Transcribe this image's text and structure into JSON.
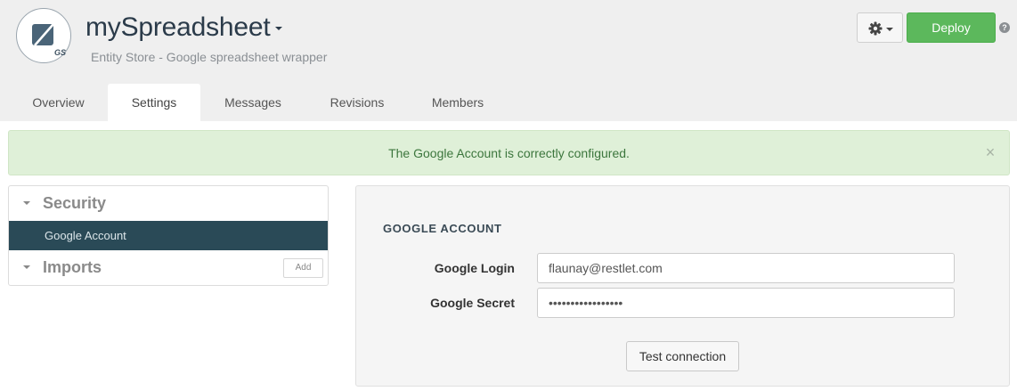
{
  "header": {
    "logo_text": "GS",
    "title": "mySpreadsheet",
    "subtitle": "Entity Store - Google spreadsheet wrapper",
    "deploy_label": "Deploy",
    "help_label": "?"
  },
  "tabs": [
    {
      "label": "Overview"
    },
    {
      "label": "Settings",
      "active": true
    },
    {
      "label": "Messages"
    },
    {
      "label": "Revisions"
    },
    {
      "label": "Members"
    }
  ],
  "alert": {
    "message": "The Google Account is correctly configured.",
    "close_label": "×"
  },
  "sidebar": {
    "sections": [
      {
        "title": "Security",
        "items": [
          {
            "label": "Google Account",
            "selected": true
          }
        ]
      },
      {
        "title": "Imports",
        "action_label": "Add"
      }
    ]
  },
  "panel": {
    "heading": "GOOGLE ACCOUNT",
    "fields": [
      {
        "label": "Google Login",
        "value": "flaunay@restlet.com"
      },
      {
        "label": "Google Secret",
        "value": "•••••••••••••••••"
      }
    ],
    "test_button_label": "Test connection"
  },
  "colors": {
    "header_bg": "#efefef",
    "deploy_green": "#5cb85c",
    "alert_bg": "#dff0d8",
    "alert_text": "#3c763d",
    "selected_item_bg": "#2a4a57"
  }
}
